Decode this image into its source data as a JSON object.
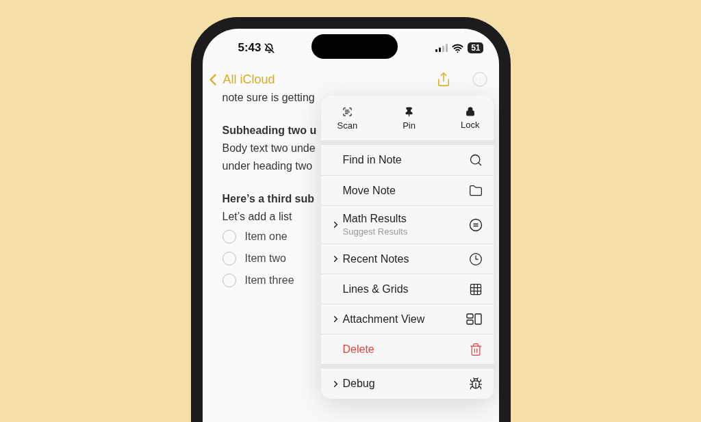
{
  "status_bar": {
    "time": "5:43",
    "battery": "51"
  },
  "nav": {
    "back": "All iCloud"
  },
  "note": {
    "lines": [
      {
        "kind": "body",
        "text": "note sure is getting"
      },
      {
        "kind": "heading",
        "text": "Subheading two u"
      },
      {
        "kind": "body",
        "text": "Body text two unde"
      },
      {
        "kind": "body",
        "text": "under heading two"
      },
      {
        "kind": "heading",
        "text": "Here’s a third sub"
      },
      {
        "kind": "body",
        "text": "Let’s add a list"
      }
    ],
    "checklist": [
      {
        "text": "Item one",
        "checked": false
      },
      {
        "text": "Item two",
        "checked": false
      },
      {
        "text": "Item three",
        "checked": false
      }
    ]
  },
  "menu": {
    "actions": [
      {
        "label": "Scan"
      },
      {
        "label": "Pin"
      },
      {
        "label": "Lock"
      }
    ],
    "groups": [
      [
        {
          "label": "Find in Note",
          "submenu": false,
          "destructive": false
        },
        {
          "label": "Move Note",
          "submenu": false,
          "destructive": false
        },
        {
          "label": "Math Results",
          "subtitle": "Suggest Results",
          "submenu": true,
          "destructive": false
        },
        {
          "label": "Recent Notes",
          "submenu": true,
          "destructive": false
        },
        {
          "label": "Lines & Grids",
          "submenu": false,
          "destructive": false
        },
        {
          "label": "Attachment View",
          "submenu": true,
          "destructive": false
        },
        {
          "label": "Delete",
          "submenu": false,
          "destructive": true
        }
      ],
      [
        {
          "label": "Debug",
          "submenu": true,
          "destructive": false
        }
      ]
    ]
  }
}
